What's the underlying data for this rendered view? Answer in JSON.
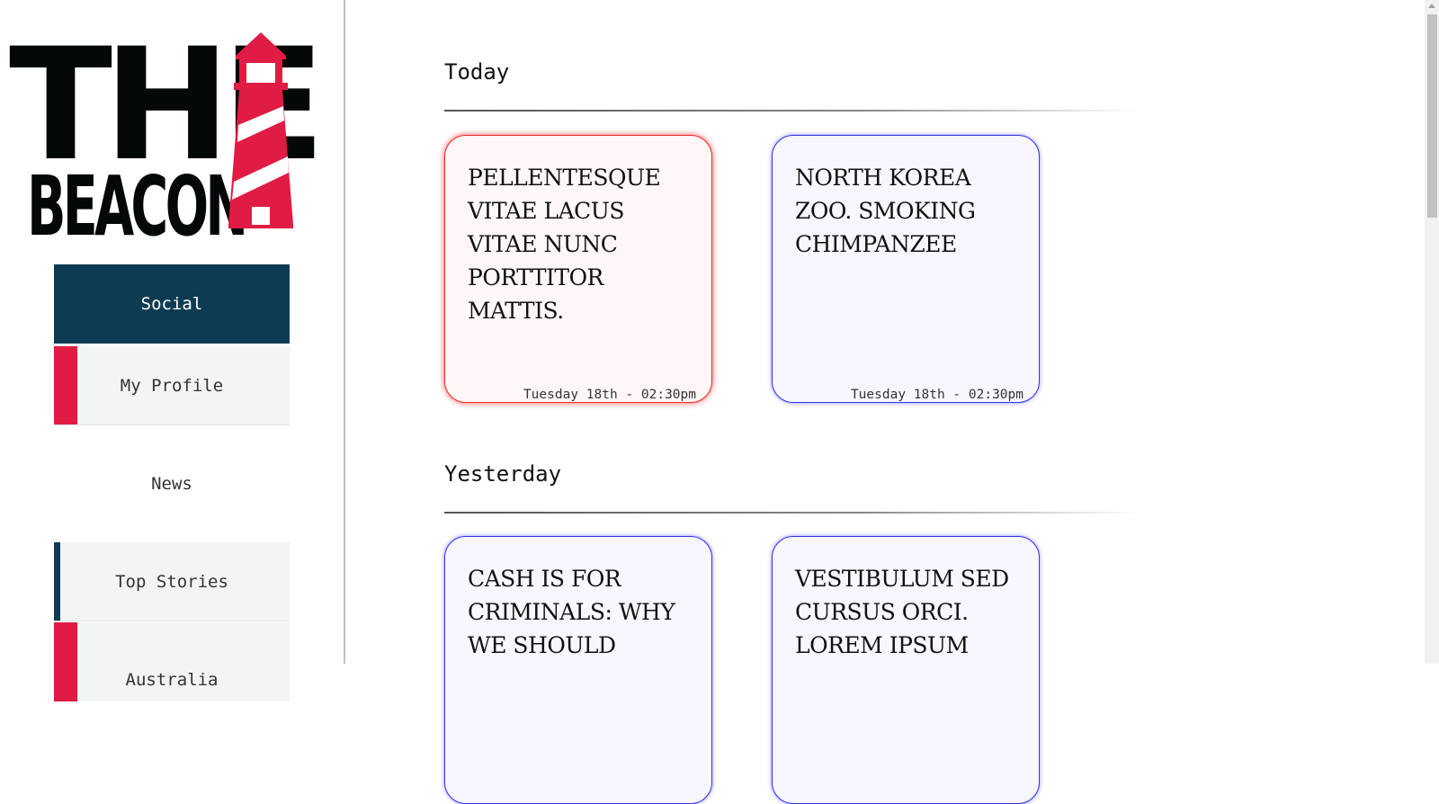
{
  "brand": {
    "line1": "THE",
    "line2": "BEACON",
    "colors": {
      "dark": "#050808",
      "red": "#e01c44"
    }
  },
  "nav": {
    "social": "Social",
    "my_profile": "My Profile",
    "news": "News",
    "top_stories": "Top Stories",
    "australia": "Australia"
  },
  "sections": {
    "today": {
      "title": "Today",
      "cards": [
        {
          "headline": "PELLENTESQUE VITAE LACUS VITAE NUNC PORTTITOR MATTIS.",
          "time": "Tuesday 18th - 02:30pm",
          "accent": "#ee2a2a"
        },
        {
          "headline": "NORTH KOREA ZOO. SMOKING CHIMPANZEE",
          "time": "Tuesday 18th - 02:30pm",
          "accent": "#3333ee"
        }
      ]
    },
    "yesterday": {
      "title": "Yesterday",
      "cards": [
        {
          "headline": "CASH IS FOR CRIMINALS: WHY WE SHOULD",
          "accent": "#3333ee"
        },
        {
          "headline": "VESTIBULUM SED CURSUS ORCI. LOREM IPSUM",
          "accent": "#3333ee"
        }
      ]
    }
  },
  "theme": {
    "nav_active_bg": "#0d3c52",
    "nav_item_bg": "#f3f4f6",
    "accent_red": "#e01c44"
  }
}
